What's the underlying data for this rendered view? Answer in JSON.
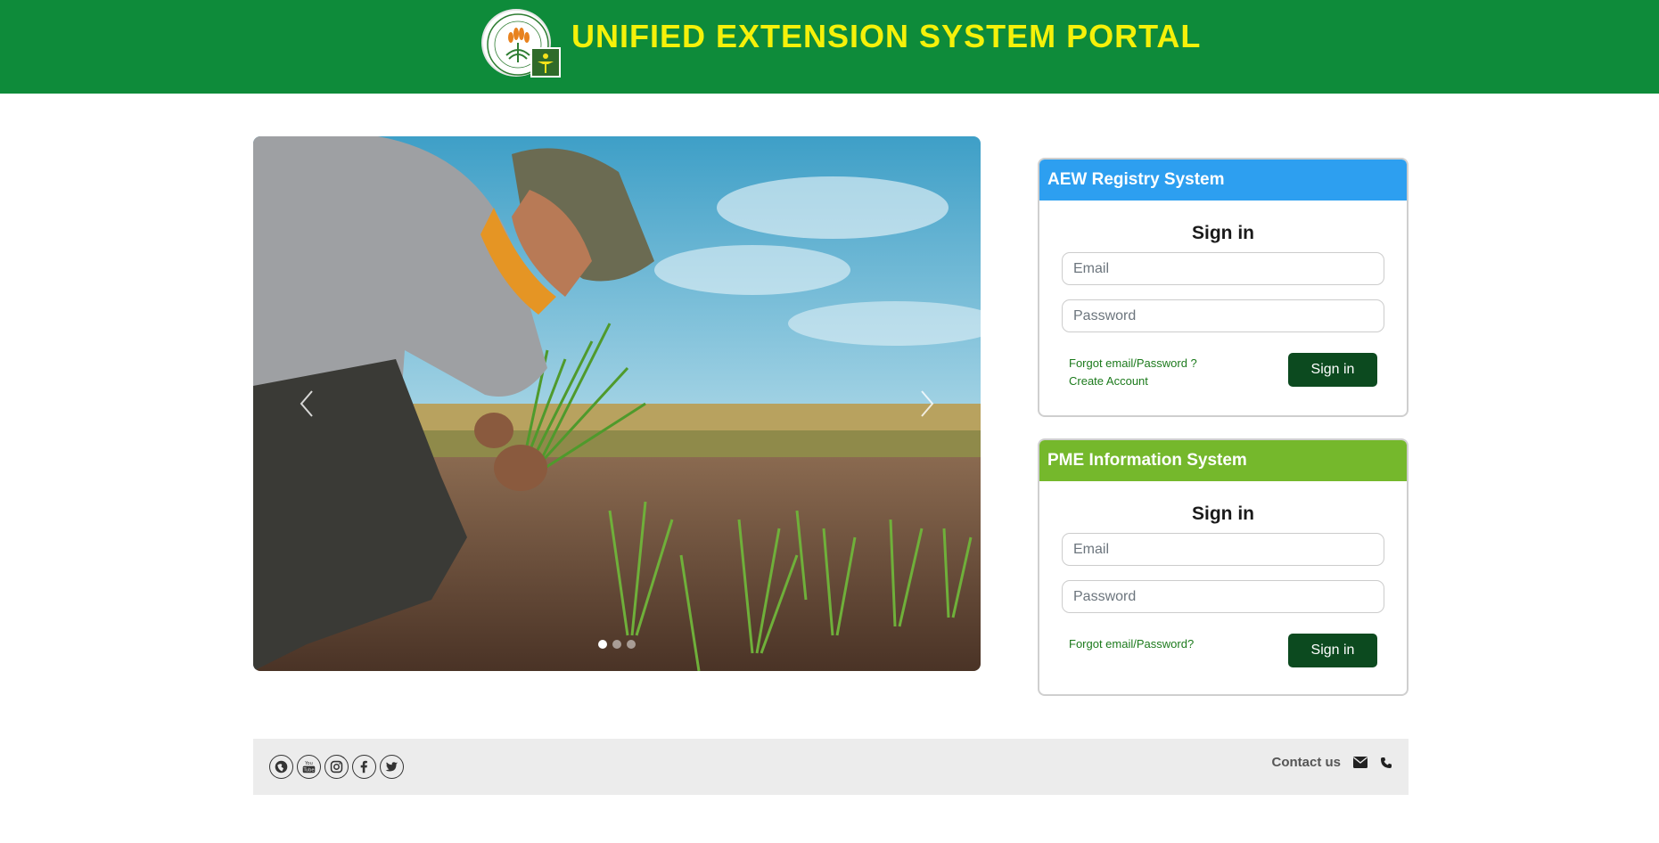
{
  "header": {
    "title": "UNIFIED EXTENSION SYSTEM PORTAL",
    "logo_icon": "department-of-agriculture-seal"
  },
  "carousel": {
    "slide_count": 3,
    "active_slide": 1
  },
  "aew": {
    "title": "AEW Registry System",
    "sign_in_heading": "Sign in",
    "email_placeholder": "Email",
    "password_placeholder": "Password",
    "forgot_link": "Forgot email/Password ?",
    "create_link": "Create Account",
    "button_label": "Sign in",
    "header_color": "#2d9ff0"
  },
  "pme": {
    "title": "PME Information System",
    "sign_in_heading": "Sign in",
    "email_placeholder": "Email",
    "password_placeholder": "Password",
    "forgot_link": "Forgot email/Password?",
    "button_label": "Sign in",
    "header_color": "#75b82c"
  },
  "footer": {
    "social_icons": [
      "globe-icon",
      "youtube-icon",
      "instagram-icon",
      "facebook-icon",
      "twitter-icon"
    ],
    "contact_label": "Contact us",
    "contact_icons": [
      "envelope-icon",
      "phone-icon"
    ]
  },
  "colors": {
    "header_bg": "#0e8b3a",
    "title_yellow": "#f5f10a",
    "button_bg": "#0c4a1f",
    "link_green": "#1c7a1c"
  }
}
